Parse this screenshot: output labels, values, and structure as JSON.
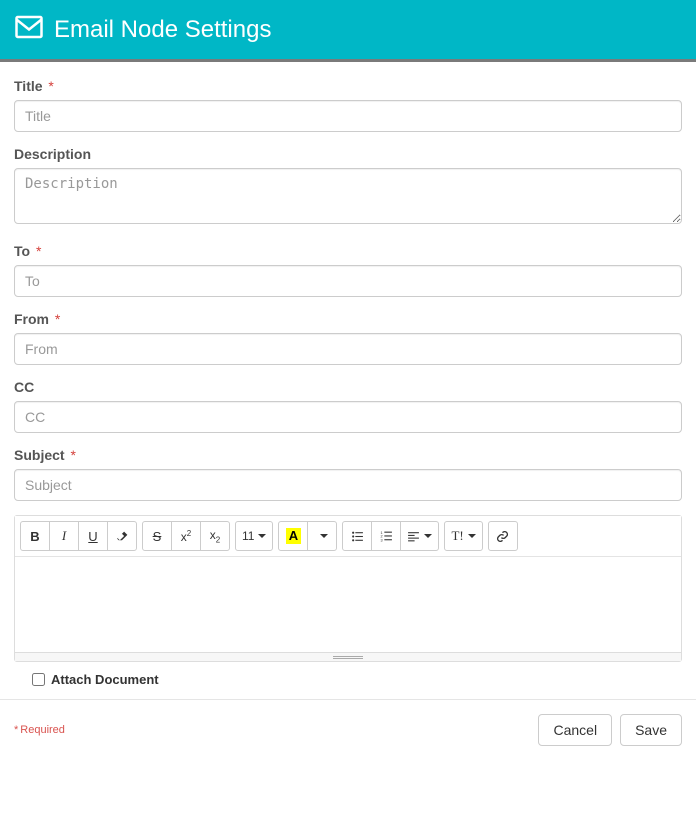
{
  "header": {
    "title": "Email Node Settings"
  },
  "fields": {
    "title": {
      "label": "Title",
      "placeholder": "Title",
      "required": true,
      "value": ""
    },
    "description": {
      "label": "Description",
      "placeholder": "Description",
      "required": false,
      "value": ""
    },
    "to": {
      "label": "To",
      "placeholder": "To",
      "required": true,
      "value": ""
    },
    "from": {
      "label": "From",
      "placeholder": "From",
      "required": true,
      "value": ""
    },
    "cc": {
      "label": "CC",
      "placeholder": "CC",
      "required": false,
      "value": ""
    },
    "subject": {
      "label": "Subject",
      "placeholder": "Subject",
      "required": true,
      "value": ""
    }
  },
  "toolbar": {
    "font_size_label": "11",
    "font_color_glyph": "A",
    "paragraph_label": "T!"
  },
  "attach": {
    "label": "Attach Document",
    "checked": false
  },
  "footer": {
    "required_note": "Required",
    "cancel": "Cancel",
    "save": "Save"
  },
  "required_marker": "*"
}
